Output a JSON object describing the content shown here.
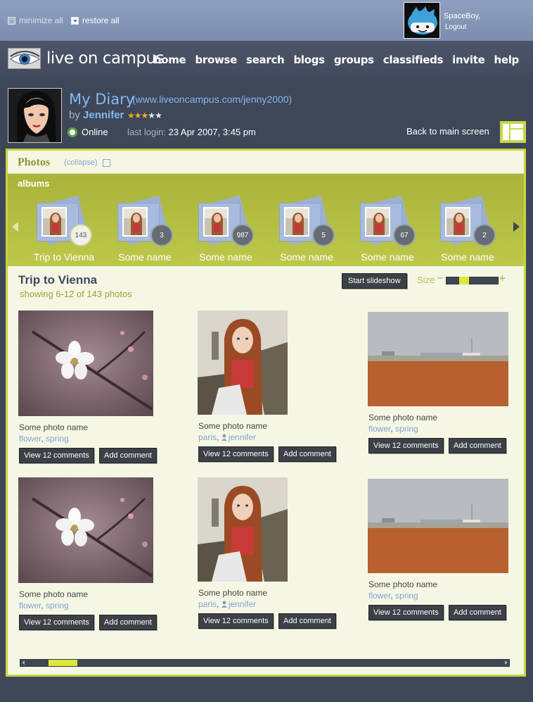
{
  "topbar": {
    "minimize_all": "minimize all",
    "restore_all": "restore all",
    "user_name": "SpaceBoy,",
    "logout": "Logout"
  },
  "header": {
    "logo_text": "live on campus",
    "nav": [
      "home",
      "browse",
      "search",
      "blogs",
      "groups",
      "classifieds",
      "invite",
      "help"
    ]
  },
  "profile": {
    "title": "My Diary",
    "url": "(www.liveoncampus.com/jenny2000)",
    "by": "by",
    "author": "Jennifer",
    "rating": 3,
    "rating_max": 5,
    "status": "Online",
    "last_login_label": "last login:",
    "last_login_value": "23 Apr 2007, 3:45 pm",
    "back_main": "Back to main screen"
  },
  "photos_panel": {
    "title": "Photos",
    "collapse": "(collapse)",
    "albums_label": "albums",
    "albums": [
      {
        "name": "Trip to Vienna",
        "count": "143",
        "active": true
      },
      {
        "name": "Some name",
        "count": "3"
      },
      {
        "name": "Some name",
        "count": "987"
      },
      {
        "name": "Some name",
        "count": "5"
      },
      {
        "name": "Some name",
        "count": "67"
      },
      {
        "name": "Some name",
        "count": "2"
      }
    ],
    "album_title": "Trip to Vienna",
    "showing": "showing 6-12 of 143 photos",
    "slideshow": "Start slideshow",
    "size_label": "Size",
    "size_minus": "–",
    "size_plus": "+",
    "size_level": 0.35,
    "scroll_position": 0.07,
    "photos": [
      {
        "name": "Some photo name",
        "tag1": "flower",
        "tag2": "spring",
        "view": "View 12 comments",
        "add": "Add comment"
      },
      {
        "name": "Some photo name",
        "tag1": "paris",
        "tag2": "jennifer",
        "view": "View 12 comments",
        "add": "Add comment"
      },
      {
        "name": "Some photo name",
        "tag1": "flower",
        "tag2": "spring",
        "view": "View 12 comments",
        "add": "Add comment"
      },
      {
        "name": "Some photo name",
        "tag1": "flower",
        "tag2": "spring",
        "view": "View 12 comments",
        "add": "Add comment"
      },
      {
        "name": "Some photo name",
        "tag1": "paris",
        "tag2": "jennifer",
        "view": "View 12 comments",
        "add": "Add comment"
      },
      {
        "name": "Some photo name",
        "tag1": "flower",
        "tag2": "spring",
        "view": "View 12 comments",
        "add": "Add comment"
      }
    ]
  }
}
